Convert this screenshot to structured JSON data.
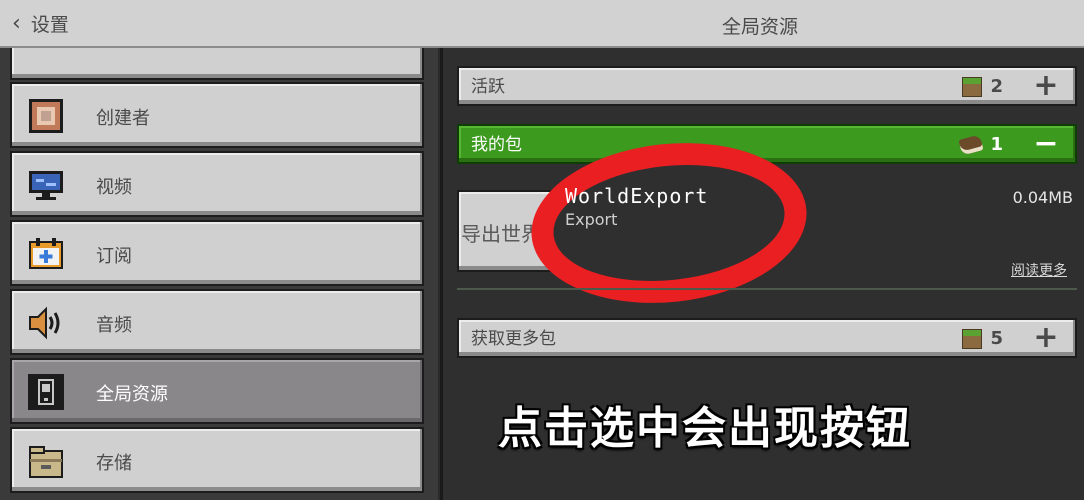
{
  "topbar": {
    "back_label": "设置",
    "title": "全局资源"
  },
  "sidebar": {
    "items": [
      {
        "label": "",
        "icon": "partial-icon"
      },
      {
        "label": "创建者",
        "icon": "command-block-icon"
      },
      {
        "label": "视频",
        "icon": "monitor-icon"
      },
      {
        "label": "订阅",
        "icon": "calendar-plus-icon"
      },
      {
        "label": "音频",
        "icon": "speaker-icon"
      },
      {
        "label": "全局资源",
        "icon": "device-icon",
        "selected": true
      },
      {
        "label": "存储",
        "icon": "folder-box-icon"
      }
    ]
  },
  "sections": {
    "active": {
      "label": "活跃",
      "count": "2"
    },
    "my_packs": {
      "label": "我的包",
      "count": "1"
    },
    "get_more": {
      "label": "获取更多包",
      "count": "5"
    }
  },
  "pack": {
    "export_button_label": "导出世界",
    "name": "WorldExport",
    "subtitle": "Export",
    "size": "0.04MB",
    "read_more": "阅读更多"
  },
  "caption": "点击选中会出现按钮",
  "colors": {
    "accent_green": "#3c9a1e",
    "annotation_red": "#ea1f22"
  }
}
